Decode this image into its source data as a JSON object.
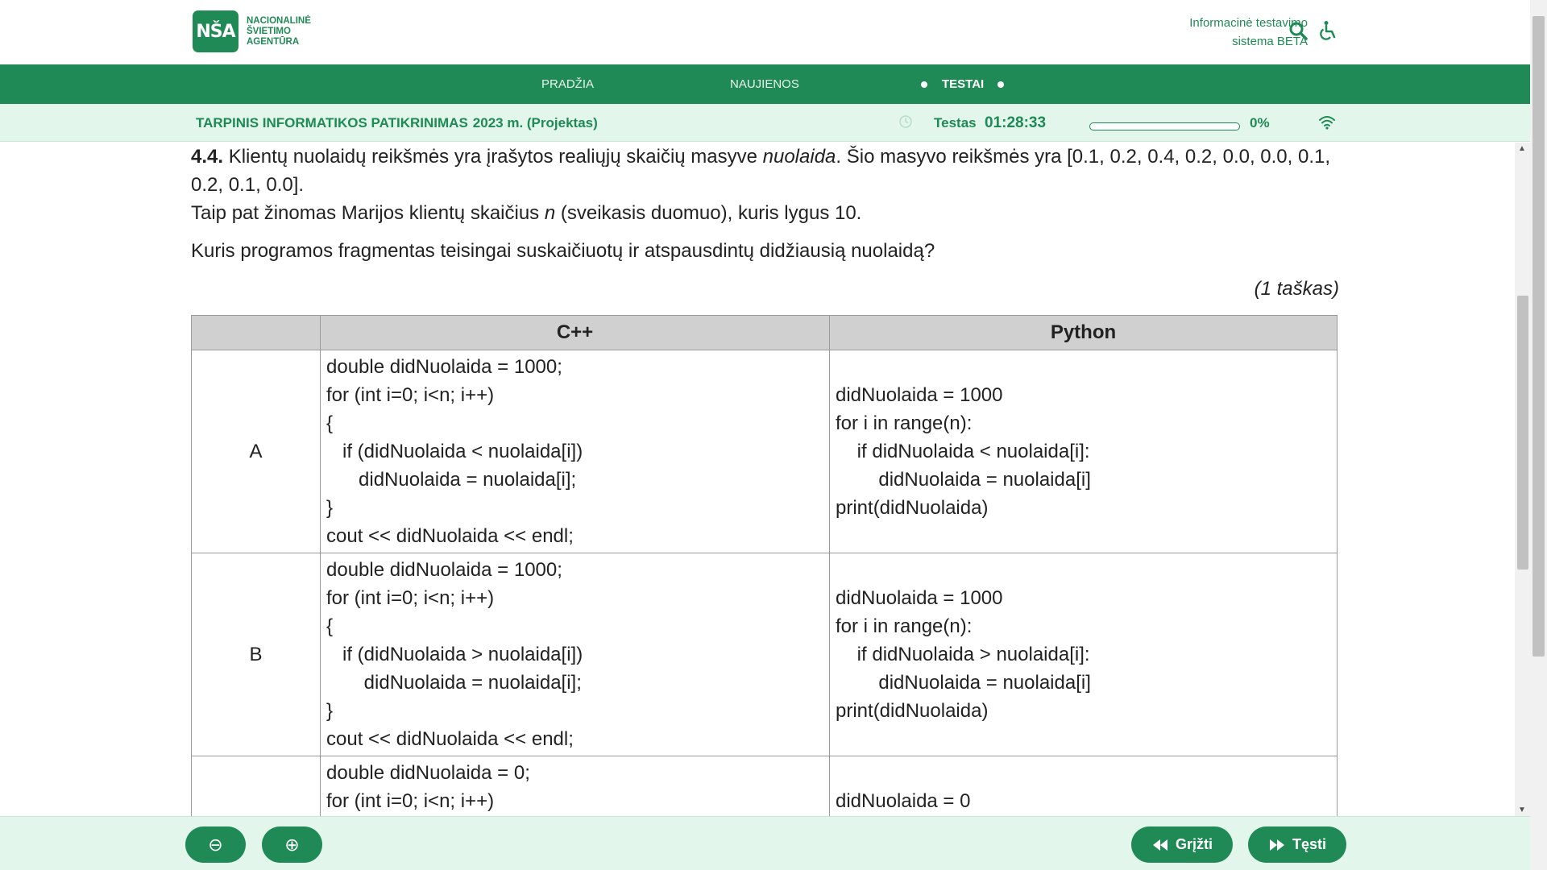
{
  "header": {
    "logo_mark": "NŠA",
    "logo_lines": [
      "NACIONALINĖ",
      "ŠVIETIMO",
      "AGENTŪRA"
    ],
    "system_line1": "Informacinė testavimo",
    "system_line2": "sistema BETA",
    "search_icon": "search-icon",
    "accessibility_icon": "accessibility-icon"
  },
  "nav": {
    "items": [
      {
        "label": "PRADŽIA",
        "active": false
      },
      {
        "label": "NAUJIENOS",
        "active": false
      },
      {
        "label": "TESTAI",
        "active": true
      }
    ]
  },
  "info_bar": {
    "title": "TARPINIS INFORMATIKOS PATIKRINIMAS",
    "subtitle": "2023 m. (Projektas)",
    "timer_label": "Testas",
    "timer_value": "01:28:33",
    "progress_percent": 0,
    "progress_text": "0%",
    "accent_color": "#1f8a55"
  },
  "question": {
    "number": "4.4.",
    "text_before_italic": " Klientų nuolaidų reikšmės yra įrašytos realiųjų skaičių masyve ",
    "italic_word": "nuolaida",
    "text_after_italic": ". Šio masyvo reikšmės yra [0.1, 0.2, 0.4, 0.2, 0.0, 0.0, 0.1, 0.2, 0.1, 0.0].",
    "line2_before": "Taip pat žinomas Marijos klientų skaičius ",
    "line2_italic": "n",
    "line2_after": " (sveikasis duomuo), kuris lygus 10.",
    "ask": "Kuris programos fragmentas teisingai suskaičiuotų ir atspausdintų didžiausią nuolaidą?",
    "points": "(1 taškas)"
  },
  "table": {
    "headers": [
      "",
      "C++",
      "Python"
    ],
    "rows": [
      {
        "option": "A",
        "cpp": [
          "double didNuolaida = 1000;",
          "for (int i=0; i<n; i++)",
          "{",
          "   if (didNuolaida < nuolaida[i])",
          "      didNuolaida = nuolaida[i];",
          "}",
          "cout << didNuolaida << endl;"
        ],
        "python": [
          "didNuolaida = 1000",
          "for i in range(n):",
          "    if didNuolaida < nuolaida[i]:",
          "        didNuolaida = nuolaida[i]",
          "print(didNuolaida)"
        ]
      },
      {
        "option": "B",
        "cpp": [
          "double didNuolaida = 1000;",
          "for (int i=0; i<n; i++)",
          "{",
          "   if (didNuolaida > nuolaida[i])",
          "       didNuolaida = nuolaida[i];",
          "}",
          "cout << didNuolaida << endl;"
        ],
        "python": [
          "didNuolaida = 1000",
          "for i in range(n):",
          "    if didNuolaida > nuolaida[i]:",
          "        didNuolaida = nuolaida[i]",
          "print(didNuolaida)"
        ]
      },
      {
        "option": "",
        "cpp": [
          "double didNuolaida = 0;",
          "for (int i=0; i<n; i++)"
        ],
        "python": [
          "",
          "didNuolaida = 0"
        ]
      }
    ]
  },
  "bottom": {
    "zoom_out_symbol": "⊖",
    "zoom_in_symbol": "⊕",
    "back_label": "Grįžti",
    "next_label": "Tęsti"
  }
}
